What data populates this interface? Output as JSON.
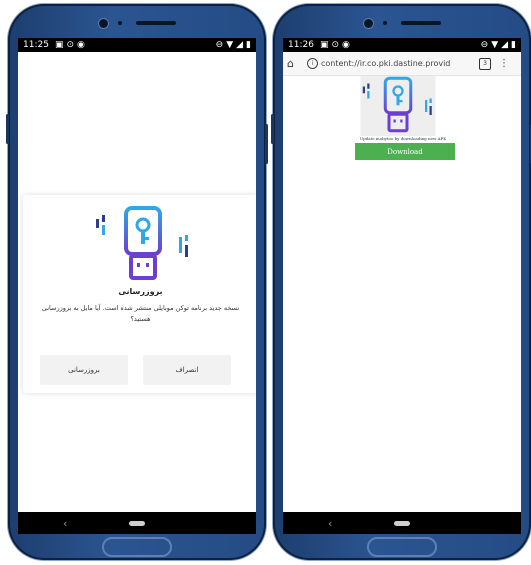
{
  "left_phone": {
    "status": {
      "time": "11:25",
      "icons": [
        "notification-icon",
        "sync-icon",
        "vpn-icon"
      ],
      "right_icons": [
        "key-icon",
        "wifi-icon",
        "signal-icon",
        "battery-icon"
      ]
    },
    "dialog": {
      "title": "بروزرسانی",
      "message": "نسخه جدید برنامه توکن موبایلی منتشر شده است. آیا مایل به بروزرسانی هستید؟",
      "update_label": "بروزرسانی",
      "cancel_label": "انصراف"
    },
    "nav": {
      "back": "‹"
    }
  },
  "right_phone": {
    "status": {
      "time": "11:26",
      "icons": [
        "notification-icon",
        "sync-icon",
        "vpn-icon"
      ],
      "right_icons": [
        "key-icon",
        "wifi-icon",
        "signal-icon",
        "battery-icon"
      ]
    },
    "browser": {
      "url": "content://ir.co.pki.dastine.provid",
      "tab_count": "3"
    },
    "page": {
      "caption": "Update mobytoo by downloading new APK",
      "download_label": "Download"
    },
    "nav": {
      "back": "‹"
    }
  },
  "colors": {
    "accent_green": "#4caf50",
    "phone_blue": "#2b5591"
  }
}
